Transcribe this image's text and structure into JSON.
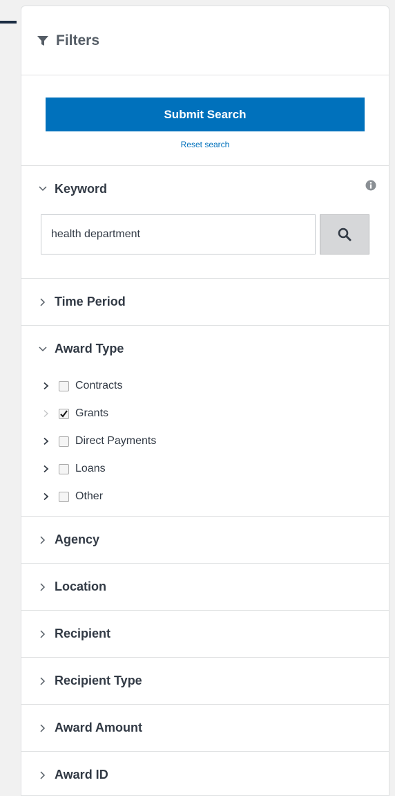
{
  "sidebar": {
    "title": "Filters",
    "submit_label": "Submit Search",
    "reset_label": "Reset search",
    "keyword": {
      "title": "Keyword",
      "value": "health department",
      "placeholder": ""
    },
    "time_period": {
      "title": "Time Period"
    },
    "award_type": {
      "title": "Award Type",
      "items": [
        {
          "label": "Contracts",
          "checked": false
        },
        {
          "label": "Grants",
          "checked": true
        },
        {
          "label": "Direct Payments",
          "checked": false
        },
        {
          "label": "Loans",
          "checked": false
        },
        {
          "label": "Other",
          "checked": false
        }
      ]
    },
    "sections": [
      {
        "title": "Agency"
      },
      {
        "title": "Location"
      },
      {
        "title": "Recipient"
      },
      {
        "title": "Recipient Type"
      },
      {
        "title": "Award Amount"
      },
      {
        "title": "Award ID"
      }
    ]
  },
  "colors": {
    "accent": "#0071bc",
    "header_dark": "#1b2d43",
    "border": "#dfe1e2"
  },
  "icons": {
    "filter": "funnel-icon",
    "info": "info-icon",
    "search": "magnifier-icon",
    "expand": "chevron-right-icon",
    "collapse": "chevron-down-icon",
    "check": "checkmark-icon"
  }
}
